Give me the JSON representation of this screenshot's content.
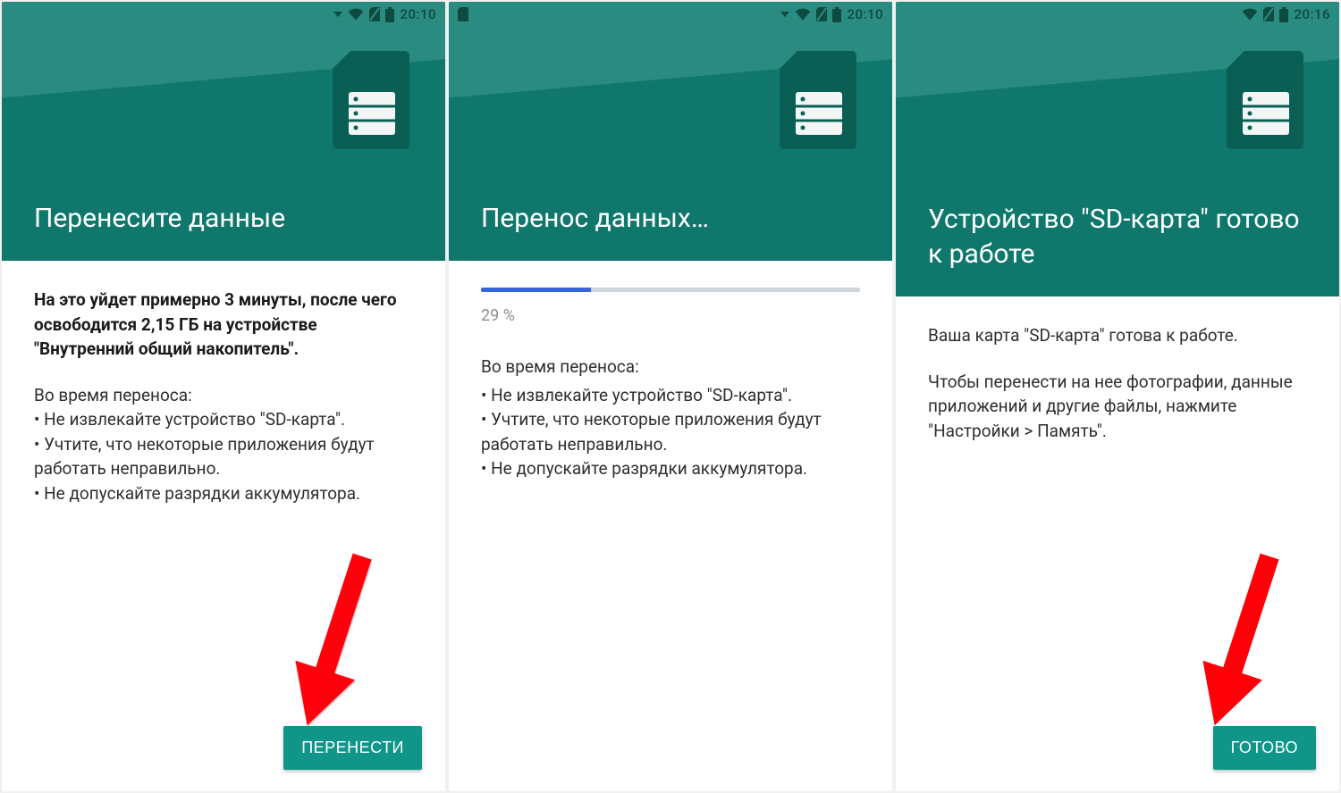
{
  "colors": {
    "header_bg": "#0f776b",
    "header_light": "#2a8b80",
    "accent_button": "#0f9688",
    "progress_fill": "#3367d6",
    "progress_track": "#cfd4d8",
    "arrow": "#ff0008"
  },
  "screens": [
    {
      "status": {
        "has_sd_left": false,
        "time": "20:10"
      },
      "title": "Перенесите данные",
      "lead_bold": "На это уйдет примерно 3 минуты, после чего освободится 2,15 ГБ на устройстве \"Внутренний общий накопитель\".",
      "intro": "Во время переноса:",
      "bullets": [
        "• Не извлекайте устройство \"SD-карта\".",
        "• Учтите, что некоторые приложения будут работать неправильно.",
        "• Не допускайте разрядки аккумулятора."
      ],
      "button": "ПЕРЕНЕСТИ",
      "has_button": true,
      "has_arrow": true
    },
    {
      "status": {
        "has_sd_left": true,
        "time": "20:10"
      },
      "title": "Перенос данных…",
      "progress": {
        "percent": 29,
        "label": "29 %"
      },
      "intro": "Во время переноса:",
      "bullets": [
        "• Не извлекайте устройство \"SD-карта\".",
        "• Учтите, что некоторые приложения будут работать неправильно.",
        "• Не допускайте разрядки аккумулятора."
      ],
      "has_button": false,
      "has_arrow": false
    },
    {
      "status": {
        "has_sd_left": false,
        "time": "20:16"
      },
      "title": "Устройство \"SD-карта\" готово к работе",
      "tall_header": true,
      "paragraphs": [
        "Ваша карта \"SD-карта\" готова к работе.",
        "Чтобы перенести на нее фотографии, данные приложений и другие файлы, нажмите \"Настройки > Память\"."
      ],
      "button": "ГОТОВО",
      "has_button": true,
      "has_arrow": true
    }
  ]
}
